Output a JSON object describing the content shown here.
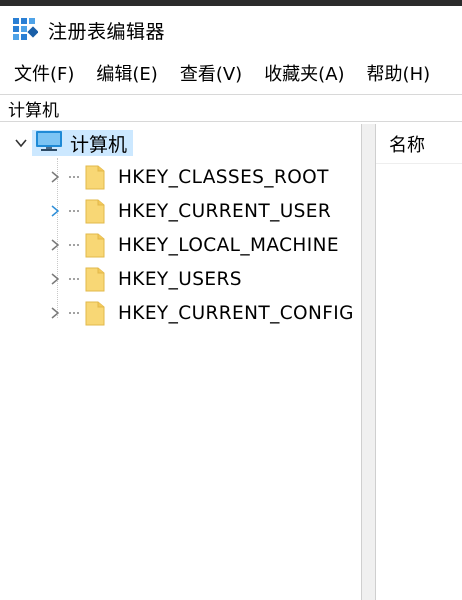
{
  "window": {
    "title": "注册表编辑器"
  },
  "menu": [
    {
      "label": "文件(F)"
    },
    {
      "label": "编辑(E)"
    },
    {
      "label": "查看(V)"
    },
    {
      "label": "收藏夹(A)"
    },
    {
      "label": "帮助(H)"
    }
  ],
  "address": {
    "path": "计算机"
  },
  "tree": {
    "root": {
      "label": "计算机",
      "expanded": true,
      "selected": true
    },
    "children": [
      {
        "label": "HKEY_CLASSES_ROOT",
        "chevron_color": "#7a7a7a"
      },
      {
        "label": "HKEY_CURRENT_USER",
        "chevron_color": "#2f8fd8"
      },
      {
        "label": "HKEY_LOCAL_MACHINE",
        "chevron_color": "#7a7a7a"
      },
      {
        "label": "HKEY_USERS",
        "chevron_color": "#7a7a7a"
      },
      {
        "label": "HKEY_CURRENT_CONFIG",
        "chevron_color": "#7a7a7a"
      }
    ]
  },
  "list": {
    "columns": [
      {
        "label": "名称"
      }
    ]
  },
  "colors": {
    "selection": "#cce8ff",
    "folder_fill": "#f8d775",
    "folder_edge": "#e2b84a",
    "splitter": "#f0f0f0"
  },
  "icons": {
    "app": "registry-editor-icon",
    "computer": "computer-icon",
    "folder": "folder-icon",
    "expand": "chevron-right-icon",
    "collapse": "chevron-down-icon"
  }
}
